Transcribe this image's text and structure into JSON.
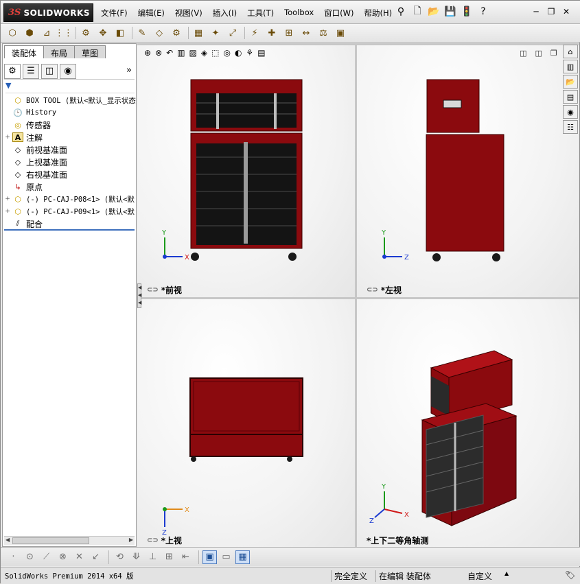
{
  "app": {
    "brand_prefix": "3S",
    "brand": "SOLIDWORKS",
    "colors": {
      "model_red": "#8b0a0e",
      "model_dark": "#1c1c1c",
      "selection_blue": "#3d6fbd",
      "axis_red": "#d01818",
      "axis_green": "#1a9a1a",
      "axis_blue": "#1a3ad0",
      "axis_orange": "#e08a1a"
    }
  },
  "menu": {
    "items": [
      "文件(F)",
      "编辑(E)",
      "视图(V)",
      "插入(I)",
      "工具(T)",
      "Toolbox",
      "窗口(W)",
      "帮助(H)"
    ]
  },
  "quick_access": {
    "icons": [
      "pin-icon",
      "new-document-icon",
      "open-folder-icon",
      "save-icon",
      "traffic-light-icon",
      "help-icon"
    ],
    "glyphs": [
      "⚲",
      "🗋",
      "📂",
      "💾",
      "🚦",
      "?"
    ]
  },
  "window_buttons": {
    "minimize": "─",
    "restore": "❐",
    "close": "✕"
  },
  "toolbar": {
    "icons": [
      "assembly-icon",
      "insert-components-icon",
      "mate-icon",
      "linear-pattern-icon",
      "smart-fasteners-icon",
      "move-component-icon",
      "show-hidden-icon",
      "assembly-features-icon",
      "reference-geometry-icon",
      "new-motion-study-icon",
      "bill-of-materials-icon",
      "exploded-view-icon",
      "explode-line-icon",
      "interference-icon",
      "clearance-icon",
      "hole-alignment-icon",
      "measure-icon",
      "mass-properties-icon",
      "instant3d-icon"
    ],
    "glyphs": [
      "⬡",
      "⬢",
      "⊿",
      "⋮⋮",
      "⚙",
      "✥",
      "◧",
      "✎",
      "◇",
      "⚙",
      "▦",
      "✦",
      "⤢",
      "⚡",
      "✚",
      "⊞",
      "↔",
      "⚖",
      "▣"
    ]
  },
  "left_panel": {
    "tabs": [
      "装配体",
      "布局",
      "草图"
    ],
    "fm_tabs": [
      "feature-manager-icon",
      "property-manager-icon",
      "configuration-manager-icon",
      "display-manager-icon"
    ],
    "fm_glyphs": [
      "⚙",
      "☰",
      "◫",
      "◉"
    ],
    "more": "»",
    "filter": "▼",
    "tree": [
      {
        "expand": "",
        "icon": "assembly-icon",
        "glyph": "⬡",
        "text": "BOX TOOL  (默认<默认_显示状态",
        "cn": false
      },
      {
        "expand": "",
        "icon": "history-icon",
        "glyph": "🕑",
        "text": "History",
        "cn": false
      },
      {
        "expand": "",
        "icon": "sensors-icon",
        "glyph": "◎",
        "text": "传感器",
        "cn": true
      },
      {
        "expand": "+",
        "icon": "annotations-icon",
        "glyph": "A",
        "text": "注解",
        "cn": true
      },
      {
        "expand": "",
        "icon": "plane-icon",
        "glyph": "◇",
        "text": "前视基准面",
        "cn": true
      },
      {
        "expand": "",
        "icon": "plane-icon",
        "glyph": "◇",
        "text": "上视基准面",
        "cn": true
      },
      {
        "expand": "",
        "icon": "plane-icon",
        "glyph": "◇",
        "text": "右视基准面",
        "cn": true
      },
      {
        "expand": "",
        "icon": "origin-icon",
        "glyph": "↳",
        "text": "原点",
        "cn": true
      },
      {
        "expand": "+",
        "icon": "part-icon",
        "glyph": "⬡",
        "text": "(-) PC-CAJ-P08<1>  (默认<默",
        "cn": false
      },
      {
        "expand": "+",
        "icon": "part-icon",
        "glyph": "⬡",
        "text": "(-) PC-CAJ-P09<1>  (默认<默",
        "cn": false
      },
      {
        "expand": "",
        "icon": "mates-icon",
        "glyph": "⫽",
        "text": "配合",
        "cn": true
      }
    ]
  },
  "viewport": {
    "hud_icons": [
      "zoom-to-fit-icon",
      "zoom-to-area-icon",
      "previous-view-icon",
      "section-view-icon",
      "dynamic-annotation-icon",
      "view-orientation-icon",
      "display-style-icon",
      "hide-show-items-icon",
      "edit-appearance-icon",
      "apply-scene-icon",
      "view-settings-icon"
    ],
    "hud_glyphs": [
      "⊕",
      "⊗",
      "↶",
      "▥",
      "▨",
      "◈",
      "⬚",
      "◎",
      "◐",
      "⚘",
      "▤"
    ],
    "pane_controls": [
      "◫",
      "◫",
      "❐",
      "✕"
    ],
    "panes": [
      {
        "label": "*前视",
        "axes": {
          "up": "Y",
          "right": "X"
        }
      },
      {
        "label": "*左视",
        "axes": {
          "up": "Y",
          "right": "Z"
        }
      },
      {
        "label": "*上视",
        "axes": {
          "up": "Z",
          "right": "X"
        }
      },
      {
        "label": "*上下二等角轴测",
        "axes": {
          "up": "Y",
          "right": "X",
          "front": "Z"
        }
      }
    ],
    "task_pane": [
      "home-icon",
      "design-library-icon",
      "file-explorer-icon",
      "view-palette-icon",
      "appearances-icon",
      "custom-properties-icon"
    ],
    "task_glyphs": [
      "⌂",
      "▥",
      "📂",
      "▤",
      "◉",
      "☷"
    ]
  },
  "sketch_toolbar": {
    "icons": [
      "point-icon",
      "circle-icon",
      "line-icon",
      "arc-icon",
      "trim-icon",
      "extend-icon",
      "offset-icon",
      "mirror-icon",
      "sketch-relations-icon",
      "grid-icon",
      "dimension-icon",
      "shaded-sketch-icon",
      "tile-horizontally-icon",
      "tile-vertically-icon"
    ],
    "glyphs": [
      "·",
      "⊙",
      "⟋",
      "⊗",
      "✕",
      "↙",
      "⟲",
      "⟱",
      "⊥",
      "⊞",
      "⇤",
      "▣",
      "▭",
      "▦"
    ],
    "active": [
      11,
      13
    ]
  },
  "status": {
    "message": "SolidWorks Premium 2014 x64 版",
    "fully_defined": "完全定义",
    "editing": "在编辑 装配体",
    "units": "自定义",
    "units_arrow": "▲",
    "tag_icon": "🏷"
  }
}
